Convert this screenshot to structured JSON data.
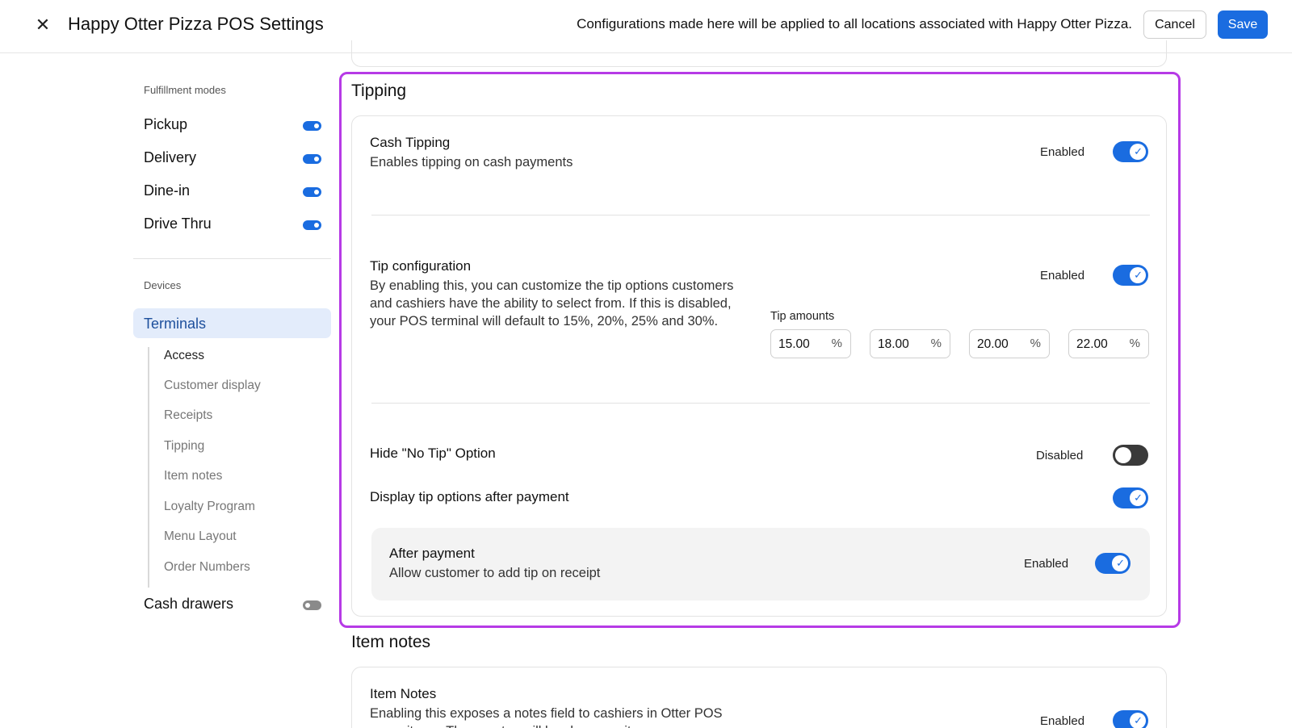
{
  "header": {
    "close_icon": "close-icon",
    "title": "Happy Otter Pizza POS Settings",
    "notice": "Configurations made here will be applied to all locations associated with Happy Otter Pizza.",
    "cancel_label": "Cancel",
    "save_label": "Save"
  },
  "colors": {
    "accent": "#1a6ce0",
    "highlight_outline": "#b63ae6",
    "active_nav_bg": "#e3ecfb"
  },
  "sidebar": {
    "fulfillment_heading": "Fulfillment modes",
    "fulfillment_modes": [
      {
        "label": "Pickup",
        "enabled": true
      },
      {
        "label": "Delivery",
        "enabled": true
      },
      {
        "label": "Dine-in",
        "enabled": true
      },
      {
        "label": "Drive Thru",
        "enabled": true
      }
    ],
    "devices_heading": "Devices",
    "active_item": "Terminals",
    "terminal_subitems": [
      "Access",
      "Customer display",
      "Receipts",
      "Tipping",
      "Item notes",
      "Loyalty Program",
      "Menu Layout",
      "Order Numbers"
    ],
    "cash_drawers": {
      "label": "Cash drawers",
      "enabled": false
    }
  },
  "tipping": {
    "title": "Tipping",
    "cash_tipping": {
      "title": "Cash Tipping",
      "description": "Enables tipping on cash payments",
      "state": "Enabled",
      "enabled": true
    },
    "tip_configuration": {
      "title": "Tip configuration",
      "description": "By enabling this, you can customize the tip options customers and cashiers have the ability to select from. If this is disabled, your POS terminal will default to 15%, 20%, 25% and 30%.",
      "state": "Enabled",
      "enabled": true,
      "amounts_label": "Tip amounts",
      "amounts": [
        "15.00",
        "18.00",
        "20.00",
        "22.00"
      ],
      "unit": "%"
    },
    "hide_no_tip": {
      "title": "Hide \"No Tip\" Option",
      "state": "Disabled",
      "enabled": false
    },
    "display_after_payment": {
      "title": "Display tip options after payment",
      "enabled": true
    },
    "after_payment": {
      "title": "After payment",
      "description": "Allow customer to add tip on receipt",
      "state": "Enabled",
      "enabled": true
    }
  },
  "item_notes": {
    "title": "Item notes",
    "row_title": "Item Notes",
    "description": "Enabling this exposes a notes field to cashiers in Otter POS menu items. These notes will be shown on items",
    "state": "Enabled",
    "enabled": true
  }
}
